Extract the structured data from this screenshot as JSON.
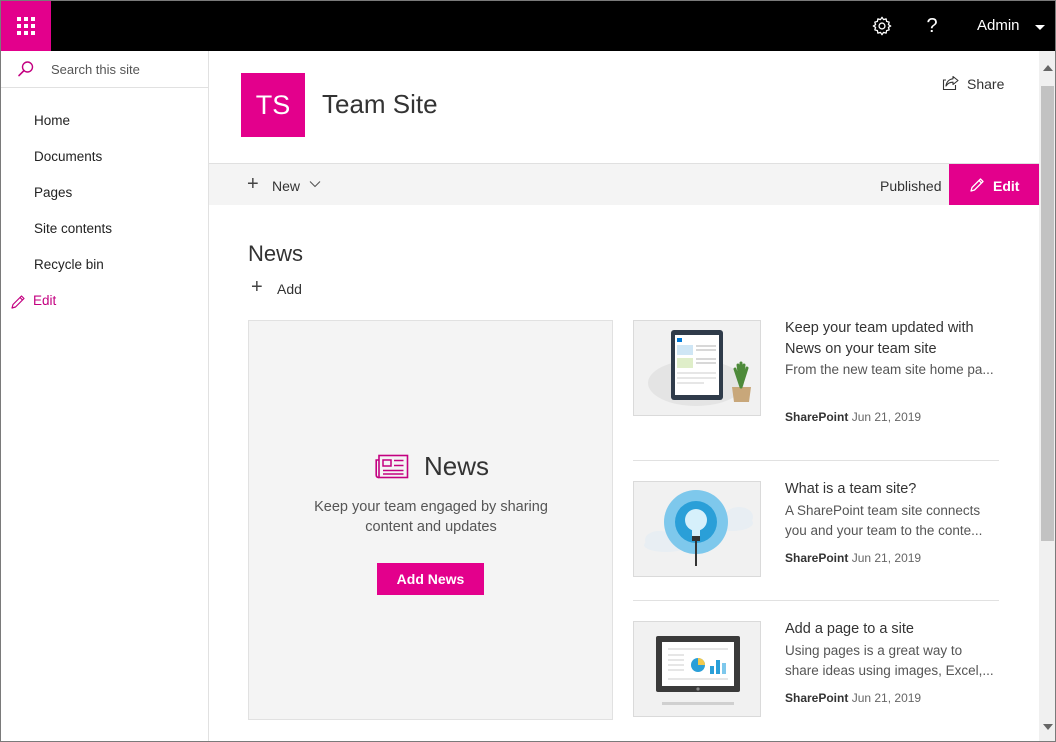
{
  "suite_bar": {
    "user_name": "Admin",
    "help_glyph": "?",
    "accent_color": "#e3008c"
  },
  "left_nav": {
    "search_placeholder": "Search this site",
    "items": [
      {
        "label": "Home"
      },
      {
        "label": "Documents"
      },
      {
        "label": "Pages"
      },
      {
        "label": "Site contents"
      },
      {
        "label": "Recycle bin"
      }
    ],
    "edit_label": "Edit"
  },
  "site_header": {
    "logo_initials": "TS",
    "title": "Team Site",
    "share_label": "Share"
  },
  "command_bar": {
    "new_label": "New",
    "status": "Published",
    "edit_label": "Edit"
  },
  "news": {
    "heading": "News",
    "add_label": "Add",
    "placeholder_card": {
      "title": "News",
      "description": "Keep your team engaged by sharing content and updates",
      "button_label": "Add News"
    },
    "items": [
      {
        "title": "Keep your team updated with News on your team site",
        "description": "From the new team site home pa...",
        "source": "SharePoint",
        "date": "Jun 21, 2019"
      },
      {
        "title": "What is a team site?",
        "description": "A SharePoint team site connects you and your team to the conte...",
        "source": "SharePoint",
        "date": "Jun 21, 2019"
      },
      {
        "title": "Add a page to a site",
        "description": "Using pages is a great way to share ideas using images, Excel,...",
        "source": "SharePoint",
        "date": "Jun 21, 2019"
      }
    ]
  }
}
